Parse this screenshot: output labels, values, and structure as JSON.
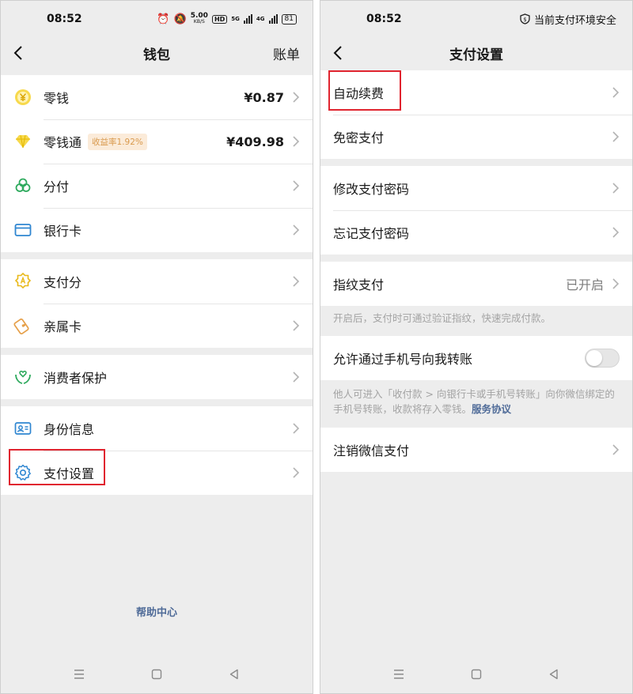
{
  "left": {
    "status": {
      "time": "08:52",
      "net_speed_value": "5.00",
      "net_speed_unit": "KB/S",
      "hd": "HD",
      "net_gen_1": "5G",
      "net_gen_2": "4G",
      "battery": "81"
    },
    "header": {
      "title": "钱包",
      "right_label": "账单"
    },
    "groups": [
      [
        {
          "label": "零钱",
          "value": "¥0.87",
          "icon": "coin-yuan-icon"
        },
        {
          "label": "零钱通",
          "badge": "收益率1.92%",
          "value": "¥409.98",
          "icon": "diamond-icon"
        },
        {
          "label": "分付",
          "icon": "clover-icon"
        },
        {
          "label": "银行卡",
          "icon": "bank-card-icon"
        }
      ],
      [
        {
          "label": "支付分",
          "icon": "badge-score-icon"
        },
        {
          "label": "亲属卡",
          "icon": "family-card-icon"
        }
      ],
      [
        {
          "label": "消费者保护",
          "icon": "hands-protect-icon"
        }
      ],
      [
        {
          "label": "身份信息",
          "icon": "id-card-icon"
        },
        {
          "label": "支付设置",
          "icon": "gear-icon"
        }
      ]
    ],
    "help_center": "帮助中心"
  },
  "right": {
    "status": {
      "time": "08:52",
      "safe_text": "当前支付环境安全"
    },
    "header": {
      "title": "支付设置"
    },
    "groups": [
      [
        {
          "label": "自动续费"
        },
        {
          "label": "免密支付"
        }
      ],
      [
        {
          "label": "修改支付密码"
        },
        {
          "label": "忘记支付密码"
        }
      ],
      [
        {
          "label": "指纹支付",
          "value": "已开启"
        }
      ]
    ],
    "fingerprint_note": "开启后，支付时可通过验证指纹，快速完成付款。",
    "phone_transfer": {
      "label": "允许通过手机号向我转账",
      "enabled": false
    },
    "phone_transfer_note": "他人可进入「收付款 > 向银行卡或手机号转账」向你微信绑定的手机号转账，收款将存入零钱。",
    "service_agreement": "服务协议",
    "cancel": {
      "label": "注销微信支付"
    }
  },
  "colors": {
    "accent_red": "#e0242f",
    "link_blue": "#4f6b98",
    "coin_yellow": "#f1c40f",
    "green": "#2faa5e",
    "blue": "#2f86d1",
    "orange": "#e6a04a"
  }
}
